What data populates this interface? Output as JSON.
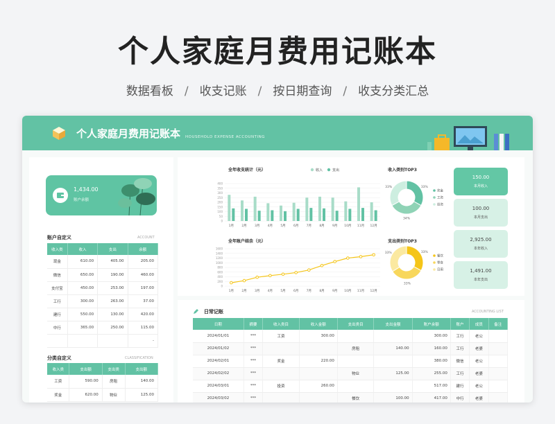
{
  "hero": {
    "title": "个人家庭月费用记账本",
    "features": [
      "数据看板",
      "收支记账",
      "按日期查询",
      "收支分类汇总"
    ],
    "separator": "/"
  },
  "app": {
    "title": "个人家庭月费用记账本",
    "title_en": "HOUSEHOLD EXPENSE ACCOUNTING"
  },
  "balance": {
    "amount": "1,434.00",
    "label": "账户余额"
  },
  "accounts": {
    "title": "账户自定义",
    "title_en": "ACCOUNT",
    "columns": [
      "收入类",
      "收入",
      "支出",
      "余额"
    ],
    "rows": [
      [
        "现金",
        "610.00",
        "405.00",
        "205.00"
      ],
      [
        "微信",
        "650.00",
        "190.00",
        "460.00"
      ],
      [
        "支付宝",
        "450.00",
        "253.00",
        "197.00"
      ],
      [
        "工行",
        "300.00",
        "263.00",
        "37.00"
      ],
      [
        "建行",
        "550.00",
        "130.00",
        "420.00"
      ],
      [
        "中行",
        "365.00",
        "250.00",
        "115.00"
      ],
      [
        "",
        "",
        "",
        "-"
      ]
    ]
  },
  "classification": {
    "title": "分类自定义",
    "title_en": "CLASSIFICATION",
    "columns": [
      "收入类",
      "支出额",
      "支出类",
      "支出额"
    ],
    "rows": [
      [
        "工资",
        "590.00",
        "房租",
        "140.00"
      ],
      [
        "奖金",
        "620.00",
        "物业",
        "125.00"
      ]
    ]
  },
  "colors": {
    "primary": "#62c2a4",
    "light": "#a8dcc8",
    "yellow": "#f5c518",
    "orange": "#f3b519"
  },
  "chart_data": [
    {
      "type": "bar",
      "title": "全年收支统计（元）",
      "categories": [
        "1月",
        "2月",
        "3月",
        "4月",
        "5月",
        "6月",
        "7月",
        "8月",
        "9月",
        "10月",
        "11月",
        "12月"
      ],
      "series": [
        {
          "name": "收入",
          "values": [
            280,
            220,
            260,
            190,
            165,
            195,
            250,
            260,
            250,
            210,
            360,
            200
          ]
        },
        {
          "name": "支出",
          "values": [
            135,
            130,
            110,
            115,
            105,
            130,
            140,
            135,
            110,
            130,
            140,
            115
          ]
        }
      ],
      "ylim": [
        0,
        400
      ],
      "yticks": [
        0,
        50,
        100,
        150,
        200,
        250,
        300,
        350,
        400
      ]
    },
    {
      "type": "line",
      "title": "全年账户结余（元）",
      "categories": [
        "1月",
        "2月",
        "3月",
        "4月",
        "5月",
        "6月",
        "7月",
        "8月",
        "9月",
        "10月",
        "11月",
        "12月"
      ],
      "series": [
        {
          "values": [
            145,
            235,
            380,
            450,
            510,
            580,
            690,
            880,
            1050,
            1200,
            1260,
            1340
          ]
        }
      ],
      "ylim": [
        0,
        1600
      ],
      "yticks": [
        0,
        200,
        400,
        600,
        800,
        1000,
        1200,
        1400,
        1600
      ]
    },
    {
      "type": "pie",
      "title": "收入类别TOP3",
      "labels": [
        "奖金",
        "工资",
        "投资"
      ],
      "values": [
        33,
        34,
        33
      ],
      "pct_labels": [
        "33%",
        "34%",
        "33%"
      ]
    },
    {
      "type": "pie",
      "title": "支出类别TOP3",
      "labels": [
        "餐饮",
        "零食",
        "日用"
      ],
      "values": [
        33,
        33,
        34
      ],
      "pct_labels": [
        "33%",
        "33%",
        "33%"
      ]
    }
  ],
  "stats": [
    {
      "value": "150.00",
      "label": "本月收入"
    },
    {
      "value": "100.00",
      "label": "本月支出"
    },
    {
      "value": "2,925.00",
      "label": "本年收入"
    },
    {
      "value": "1,491.00",
      "label": "本年支出"
    }
  ],
  "ledger": {
    "title": "日常记账",
    "title_en": "ACCOUNTING LIST",
    "columns": [
      "日期",
      "摘要",
      "收入类目",
      "收入金额",
      "支出类目",
      "支出金额",
      "账户余额",
      "账户",
      "成员",
      "备注"
    ],
    "rows": [
      [
        "2024/01/01",
        "***",
        "工资",
        "300.00",
        "",
        "",
        "300.00",
        "工行",
        "老公",
        ""
      ],
      [
        "2024/01/02",
        "***",
        "",
        "",
        "房租",
        "140.00",
        "160.00",
        "工行",
        "老婆",
        ""
      ],
      [
        "2024/02/01",
        "***",
        "奖金",
        "220.00",
        "",
        "",
        "380.00",
        "微信",
        "老公",
        ""
      ],
      [
        "2024/02/02",
        "***",
        "",
        "",
        "物业",
        "125.00",
        "255.00",
        "工行",
        "老婆",
        ""
      ],
      [
        "2024/03/01",
        "***",
        "投资",
        "260.00",
        "",
        "",
        "517.00",
        "建行",
        "老公",
        ""
      ],
      [
        "2024/03/02",
        "***",
        "",
        "",
        "餐饮",
        "100.00",
        "417.00",
        "中行",
        "老婆",
        ""
      ]
    ]
  }
}
